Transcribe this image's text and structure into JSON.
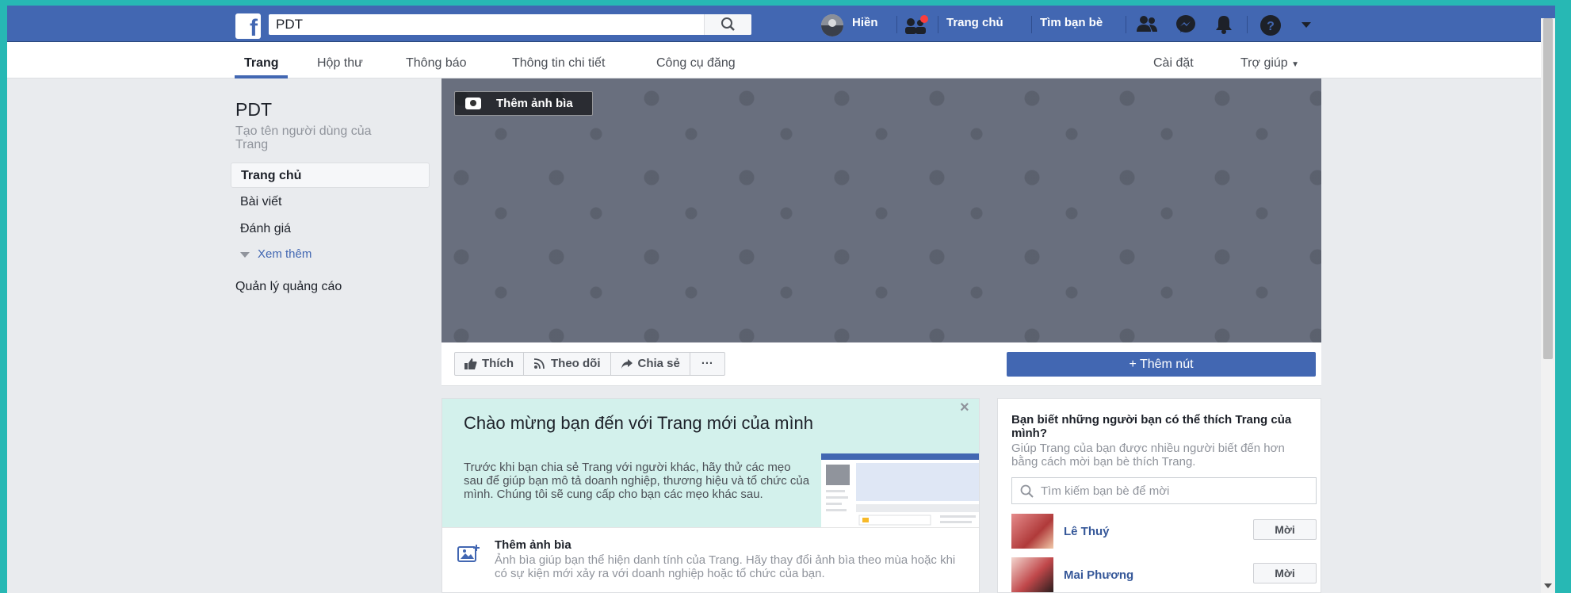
{
  "topbar": {
    "search_value": "PDT",
    "user_name": "Hiền",
    "home": "Trang chủ",
    "find_friends": "Tìm bạn bè"
  },
  "pagenav": {
    "tabs": [
      {
        "label": "Trang",
        "active": true
      },
      {
        "label": "Hộp thư"
      },
      {
        "label": "Thông báo"
      },
      {
        "label": "Thông tin chi tiết"
      },
      {
        "label": "Công cụ đăng"
      }
    ],
    "settings": "Cài đặt",
    "help": "Trợ giúp"
  },
  "sidebar": {
    "page_name": "PDT",
    "create_username": "Tạo tên người dùng của Trang",
    "items": [
      {
        "label": "Trang chủ",
        "active": true
      },
      {
        "label": "Bài viết"
      },
      {
        "label": "Đánh giá"
      }
    ],
    "see_more": "Xem thêm",
    "ads_manager": "Quản lý quảng cáo"
  },
  "cover": {
    "add_cover": "Thêm ảnh bìa"
  },
  "actions": {
    "like": "Thích",
    "follow": "Theo dõi",
    "share": "Chia sẻ",
    "more": "···",
    "add_button": "+ Thêm nút"
  },
  "welcome": {
    "title": "Chào mừng bạn đến với Trang mới của mình",
    "text": "Trước khi bạn chia sẻ Trang với người khác, hãy thử các mẹo sau để giúp bạn mô tả doanh nghiệp, thương hiệu và tổ chức của mình. Chúng tôi sẽ cung cấp cho bạn các mẹo khác sau.",
    "tip_title": "Thêm ảnh bìa",
    "tip_text": "Ảnh bìa giúp bạn thể hiện danh tính của Trang. Hãy thay đổi ảnh bìa theo mùa hoặc khi có sự kiện mới xảy ra với doanh nghiệp hoặc tổ chức của bạn."
  },
  "invite": {
    "title": "Bạn biết những người bạn có thể thích Trang của mình?",
    "text": "Giúp Trang của bạn được nhiều người biết đến hơn bằng cách mời bạn bè thích Trang.",
    "search_placeholder": "Tìm kiếm bạn bè để mời",
    "friends": [
      {
        "name": "Lê Thuý",
        "button": "Mời"
      },
      {
        "name": "Mai Phương",
        "button": "Mời"
      }
    ]
  },
  "colors": {
    "brand": "#4267b2",
    "background": "#e9ebee",
    "welcome_bg": "#d3f1ec"
  }
}
